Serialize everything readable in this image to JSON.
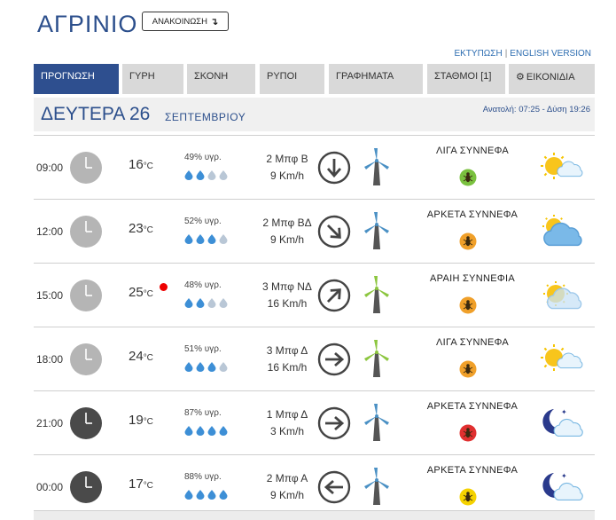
{
  "header": {
    "city": "ΑΓΡΙΝΙΟ",
    "announce_label": "ΑΝΑΚΟΙΝΩΣΗ",
    "announce_arrow": "↴"
  },
  "toplinks": {
    "print": "ΕΚΤΥΠΩΣΗ",
    "separator": "|",
    "english": "ENGLISH VERSION"
  },
  "tabs": [
    {
      "label": "ΠΡΟΓΝΩΣΗ",
      "active": true
    },
    {
      "label": "ΓΥΡΗ"
    },
    {
      "label": "ΣΚΟΝΗ"
    },
    {
      "label": "ΡΥΠΟΙ"
    },
    {
      "label": "ΓΡΑΦΗΜΑΤΑ"
    },
    {
      "label": "ΣΤΑΘΜΟΙ [1]"
    },
    {
      "label": "ΕΙΚΟΝΙΔΙΑ",
      "icon": "gear-icon"
    }
  ],
  "day": {
    "name": "ΔΕΥΤΕΡΑ 26",
    "month": "ΣΕΠΤΕΜΒΡΙΟΥ",
    "sunrise_sunset": "Ανατολή: 07:25 - Δύση 19:26"
  },
  "temp_unit": "°C",
  "rows": [
    {
      "time": "09:00",
      "period": "day",
      "temp": "16",
      "hum": "49% υγρ.",
      "drops_filled": 2,
      "wind_bft": "2 Μπφ Β",
      "wind_kmh": "9 Km/h",
      "wind_dir": "n",
      "wind_icon_color": "#4a90c4",
      "condition": "ΛΙΓΑ ΣΥΝΝΕΦΑ",
      "bug_color": "#7ac13f",
      "weather_icon": "sun-cloud-icon",
      "alert": false
    },
    {
      "time": "12:00",
      "period": "day",
      "temp": "23",
      "hum": "52% υγρ.",
      "drops_filled": 3,
      "wind_bft": "2 Μπφ ΒΔ",
      "wind_kmh": "9 Km/h",
      "wind_dir": "nw",
      "wind_icon_color": "#4a90c4",
      "condition": "ΑΡΚΕΤΑ ΣΥΝΝΕΦΑ",
      "bug_color": "#f0a02a",
      "weather_icon": "partly-cloudy-icon",
      "alert": false
    },
    {
      "time": "15:00",
      "period": "day",
      "temp": "25",
      "hum": "48% υγρ.",
      "drops_filled": 2,
      "wind_bft": "3 Μπφ ΝΔ",
      "wind_kmh": "16 Km/h",
      "wind_dir": "sw",
      "wind_icon_color": "#8cc63f",
      "condition": "ΑΡΑΙΗ ΣΥΝΝΕΦΙΑ",
      "bug_color": "#f0a02a",
      "weather_icon": "hazy-sun-icon",
      "alert": true
    },
    {
      "time": "18:00",
      "period": "day",
      "temp": "24",
      "hum": "51% υγρ.",
      "drops_filled": 3,
      "wind_bft": "3 Μπφ Δ",
      "wind_kmh": "16 Km/h",
      "wind_dir": "w",
      "wind_icon_color": "#8cc63f",
      "condition": "ΛΙΓΑ ΣΥΝΝΕΦΑ",
      "bug_color": "#f0a02a",
      "weather_icon": "sun-cloud-icon",
      "alert": false
    },
    {
      "time": "21:00",
      "period": "night",
      "temp": "19",
      "hum": "87% υγρ.",
      "drops_filled": 4,
      "wind_bft": "1 Μπφ Δ",
      "wind_kmh": "3 Km/h",
      "wind_dir": "w",
      "wind_icon_color": "#4a90c4",
      "condition": "ΑΡΚΕΤΑ ΣΥΝΝΕΦΑ",
      "bug_color": "#e03030",
      "weather_icon": "moon-cloud-icon",
      "alert": false
    },
    {
      "time": "00:00",
      "period": "night",
      "temp": "17",
      "hum": "88% υγρ.",
      "drops_filled": 4,
      "wind_bft": "2 Μπφ Α",
      "wind_kmh": "9 Km/h",
      "wind_dir": "e",
      "wind_icon_color": "#4a90c4",
      "condition": "ΑΡΚΕΤΑ ΣΥΝΝΕΦΑ",
      "bug_color": "#f5d200",
      "weather_icon": "moon-cloud-icon",
      "alert": false
    }
  ],
  "colors": {
    "brand": "#2c4f8c",
    "active_tab": "#2e4f8f",
    "tab": "#d9d9d9",
    "link": "#2c6cb0",
    "drop": "#3d8fd6",
    "drop_empty": "#b9c7d6"
  }
}
